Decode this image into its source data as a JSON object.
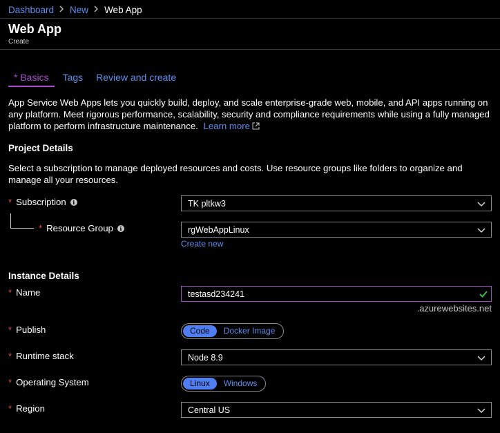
{
  "breadcrumb": {
    "items": [
      "Dashboard",
      "New"
    ],
    "current": "Web App"
  },
  "header": {
    "title": "Web App",
    "subtitle": "Create"
  },
  "tabs": [
    {
      "star": "*",
      "label": "Basics"
    },
    {
      "label": "Tags"
    },
    {
      "label": "Review and create"
    }
  ],
  "intro": {
    "text": "App Service Web Apps lets you quickly build, deploy, and scale enterprise-grade web, mobile, and API apps running on any platform. Meet rigorous performance, scalability, security and compliance requirements while using a fully managed platform to perform infrastructure maintenance.",
    "learn_more": "Learn more"
  },
  "project": {
    "heading": "Project Details",
    "description": "Select a subscription to manage deployed resources and costs. Use resource groups like folders to organize and manage all your resources.",
    "subscription": {
      "label": "Subscription",
      "value": "TK pltkw3"
    },
    "resource_group": {
      "label": "Resource Group",
      "value": "rgWebAppLinux",
      "create_new": "Create new"
    }
  },
  "instance": {
    "heading": "Instance Details",
    "name": {
      "label": "Name",
      "value": "testasd234241",
      "suffix": ".azurewebsites.net"
    },
    "publish": {
      "label": "Publish",
      "options": [
        "Code",
        "Docker Image"
      ],
      "selected": "Code"
    },
    "runtime": {
      "label": "Runtime stack",
      "value": "Node 8.9"
    },
    "os": {
      "label": "Operating System",
      "options": [
        "Linux",
        "Windows"
      ],
      "selected": "Linux"
    },
    "region": {
      "label": "Region",
      "value": "Central US"
    }
  },
  "required_mark": "*",
  "info_glyph": "i",
  "colors": {
    "link": "#5e8ded",
    "accent": "#a64ac9",
    "required": "#e24b4b",
    "toggle_selected": "#4f7ef2",
    "valid": "#3fb950"
  }
}
